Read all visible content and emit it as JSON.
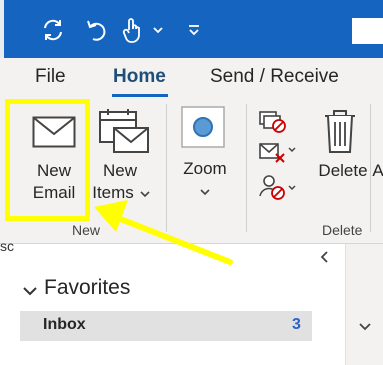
{
  "tabs": {
    "file": "File",
    "home": "Home",
    "send_receive": "Send / Receive"
  },
  "ribbon": {
    "new_email": {
      "line1": "New",
      "line2": "Email"
    },
    "new_items": {
      "line1": "New",
      "line2": "Items"
    },
    "new_group_label": "New",
    "zoom_label": "Zoom",
    "delete_label": "Delete",
    "delete_group_label": "Delete",
    "cut_off_letter": "A"
  },
  "nav": {
    "favorites": "Favorites",
    "inbox": {
      "label": "Inbox",
      "count": "3"
    }
  },
  "left_edge_text": "sc",
  "colors": {
    "title_bar": "#1565c0",
    "ribbon_bg": "#f3f2f1",
    "highlight": "#ffff00",
    "accent_blue": "#1f4e79",
    "inbox_count": "#2b63c6"
  },
  "icons": {
    "sync": "sync-icon",
    "undo": "undo-icon",
    "touch": "touch-mode-icon",
    "customize": "customize-qat-icon",
    "envelope": "envelope-icon",
    "calendar_envelope": "new-items-icon",
    "zoom": "zoom-icon",
    "ignore": "ignore-icon",
    "cleanup": "cleanup-icon",
    "junk": "junk-icon",
    "trash": "trash-icon",
    "collapse": "collapse-ribbon-icon"
  }
}
